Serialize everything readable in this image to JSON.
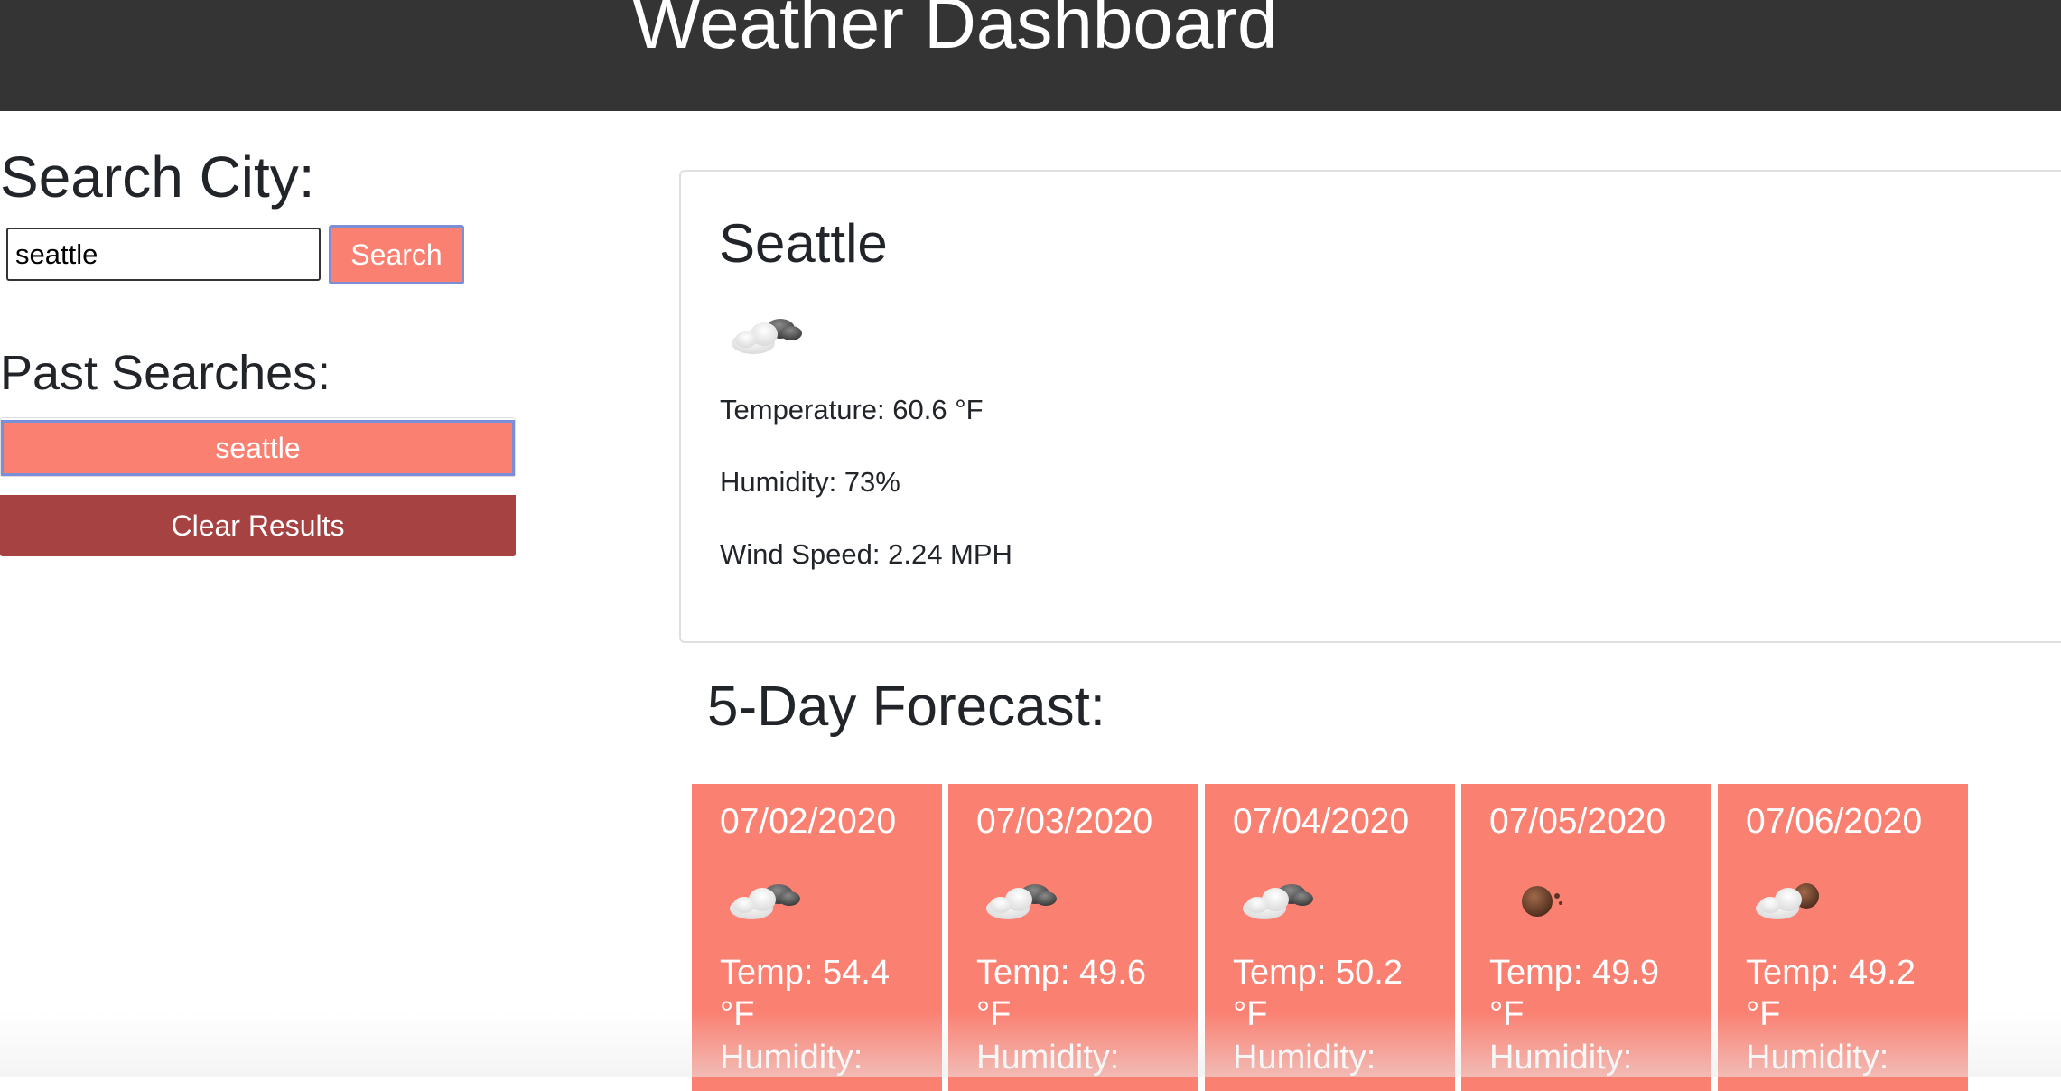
{
  "header": {
    "title": "Weather Dashboard"
  },
  "search": {
    "heading": "Search City:",
    "input_value": "seattle",
    "button_label": "Search"
  },
  "past_searches": {
    "heading": "Past Searches:",
    "items": [
      {
        "label": "seattle"
      }
    ],
    "clear_label": "Clear Results"
  },
  "current": {
    "city": "Seattle",
    "icon": "cloudy-icon",
    "temperature": "Temperature: 60.6 °F",
    "humidity": "Humidity: 73%",
    "wind": "Wind Speed: 2.24 MPH"
  },
  "forecast": {
    "heading": "5-Day Forecast:",
    "days": [
      {
        "date": "07/02/2020",
        "icon": "cloudy-icon",
        "temp": "Temp: 54.4 °F",
        "humidity": "Humidity:"
      },
      {
        "date": "07/03/2020",
        "icon": "cloudy-icon",
        "temp": "Temp: 49.6 °F",
        "humidity": "Humidity:"
      },
      {
        "date": "07/04/2020",
        "icon": "cloudy-icon",
        "temp": "Temp: 50.2 °F",
        "humidity": "Humidity:"
      },
      {
        "date": "07/05/2020",
        "icon": "night-partly-cloudy-icon",
        "temp": "Temp: 49.9 °F",
        "humidity": "Humidity:"
      },
      {
        "date": "07/06/2020",
        "icon": "night-cloudy-icon",
        "temp": "Temp: 49.2 °F",
        "humidity": "Humidity:"
      }
    ]
  },
  "colors": {
    "header_bg": "#343434",
    "accent": "#fa8072",
    "clear_button": "#a64242",
    "focus_border": "#7b8fd8"
  }
}
